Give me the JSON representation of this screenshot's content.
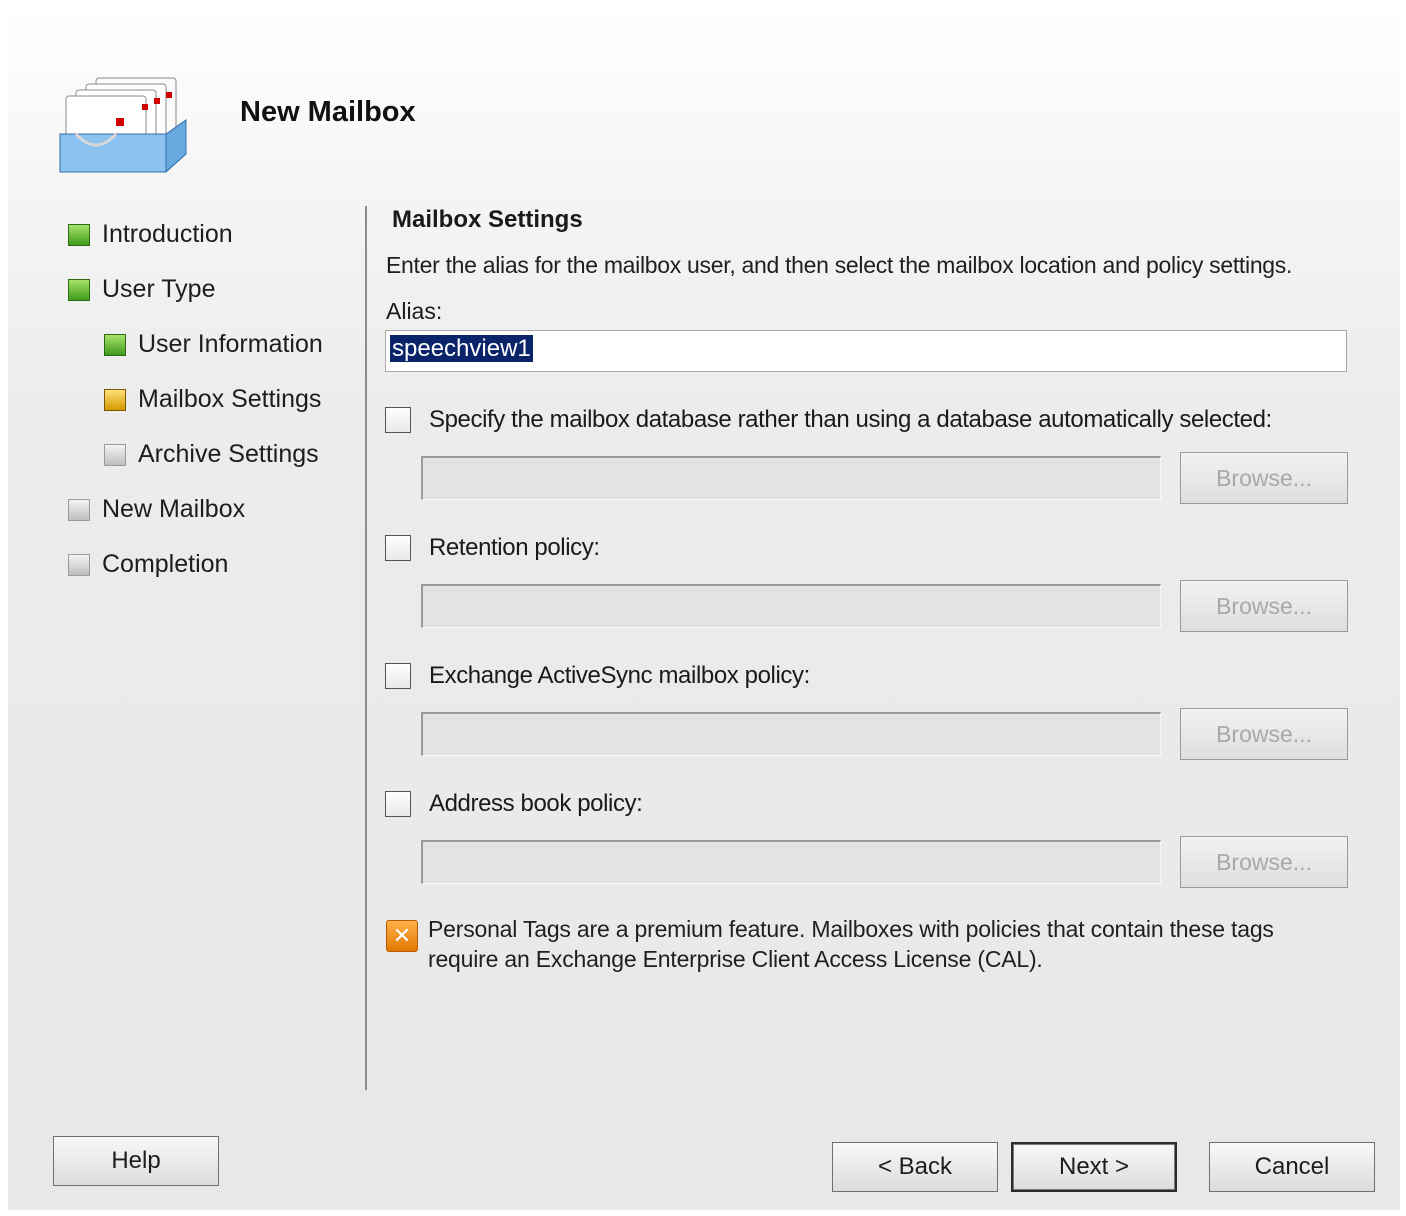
{
  "wizard": {
    "title": "New Mailbox",
    "header_icon": "mailbox-stack-icon"
  },
  "nav": {
    "items": [
      {
        "label": "Introduction",
        "status": "completed",
        "indent": 0
      },
      {
        "label": "User Type",
        "status": "completed",
        "indent": 0
      },
      {
        "label": "User Information",
        "status": "completed",
        "indent": 1
      },
      {
        "label": "Mailbox Settings",
        "status": "current",
        "indent": 1
      },
      {
        "label": "Archive Settings",
        "status": "pending",
        "indent": 1
      },
      {
        "label": "New Mailbox",
        "status": "pending",
        "indent": 0
      },
      {
        "label": "Completion",
        "status": "pending",
        "indent": 0
      }
    ],
    "colors": {
      "completed": "#3f9a1c",
      "current": "#d49a00",
      "pending": "#bdbdbd"
    }
  },
  "main": {
    "section_title": "Mailbox Settings",
    "description": "Enter the alias for the mailbox user, and then select the mailbox location and policy settings.",
    "alias_label": "Alias:",
    "alias_value": "speechview1",
    "options": [
      {
        "label": "Specify the mailbox database rather than using a database automatically selected:",
        "checked": false,
        "field_value": "",
        "browse_label": "Browse...",
        "browse_enabled": false
      },
      {
        "label": "Retention policy:",
        "checked": false,
        "field_value": "",
        "browse_label": "Browse...",
        "browse_enabled": false
      },
      {
        "label": "Exchange ActiveSync mailbox policy:",
        "checked": false,
        "field_value": "",
        "browse_label": "Browse...",
        "browse_enabled": false
      },
      {
        "label": "Address book policy:",
        "checked": false,
        "field_value": "",
        "browse_label": "Browse...",
        "browse_enabled": false
      }
    ],
    "notice_icon": "warning-icon",
    "notice_text": "Personal Tags are a premium feature. Mailboxes with policies that contain these tags require an Exchange Enterprise Client Access License (CAL)."
  },
  "footer": {
    "help_label": "Help",
    "back_label": "< Back",
    "next_label": "Next >",
    "cancel_label": "Cancel"
  }
}
